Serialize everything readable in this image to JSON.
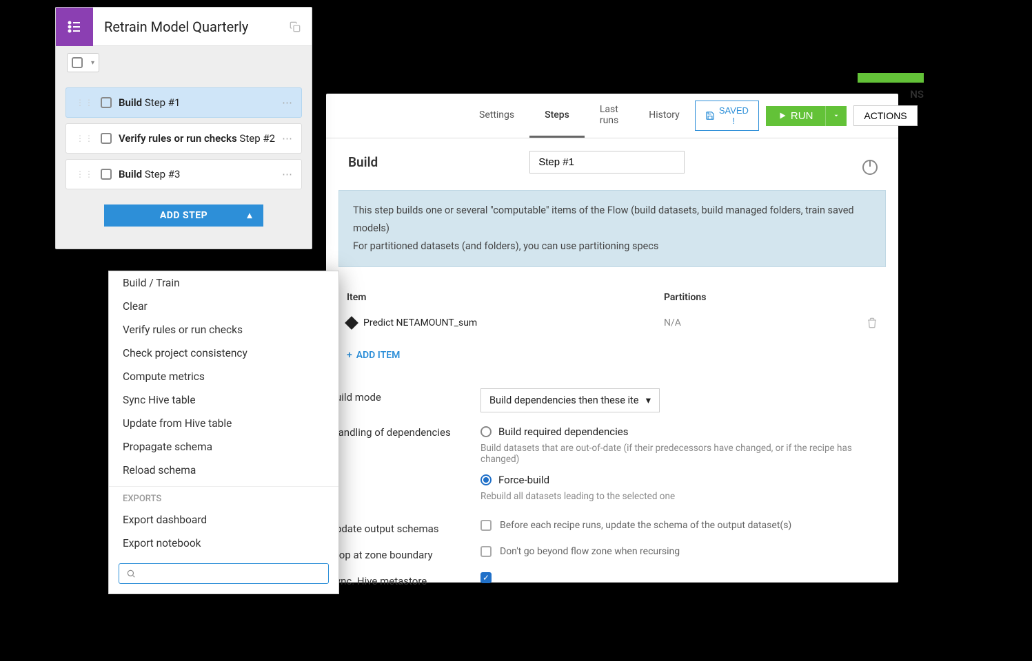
{
  "scenario": {
    "title": "Retrain Model Quarterly",
    "steps": [
      {
        "name": "Build",
        "suffix": "Step #1",
        "selected": true
      },
      {
        "name": "Verify rules or run checks",
        "suffix": "Step #2",
        "selected": false
      },
      {
        "name": "Build",
        "suffix": "Step #3",
        "selected": false
      }
    ],
    "add_step_label": "ADD STEP"
  },
  "dropdown": {
    "items": [
      "Build / Train",
      "Clear",
      "Verify rules or run checks",
      "Check project consistency",
      "Compute metrics",
      "Sync Hive table",
      "Update from Hive table",
      "Propagate schema",
      "Reload schema"
    ],
    "exports_header": "EXPORTS",
    "exports": [
      "Export dashboard",
      "Export notebook"
    ]
  },
  "main": {
    "tabs": {
      "settings": "Settings",
      "steps": "Steps",
      "last_runs": "Last runs",
      "history": "History"
    },
    "saved": "SAVED !",
    "run": "RUN",
    "actions": "ACTIONS",
    "ns_fragment": "NS",
    "step_title": "Build",
    "step_name": "Step #1",
    "banner_line1": "This step builds one or several \"computable\" items of the Flow (build datasets, build managed folders, train saved models)",
    "banner_line2": "For partitioned datasets (and folders), you can use partitioning specs",
    "items_header": {
      "item": "Item",
      "partitions": "Partitions"
    },
    "item_row": {
      "name": "Predict NETAMOUNT_sum",
      "partitions": "N/A"
    },
    "add_item": "ADD ITEM",
    "form": {
      "build_mode_label": "uild mode",
      "build_mode_value": "Build dependencies then these ite",
      "handling_label": "landling of dependencies",
      "dep_option1": "Build required dependencies",
      "dep_help1": "Build datasets that are out-of-date (if their predecessors have changed, or if the recipe has changed)",
      "dep_option2": "Force-build",
      "dep_help2": "Rebuild all datasets leading to the selected one",
      "update_label": "pdate output schemas",
      "update_help": "Before each recipe runs, update the schema of the output dataset(s)",
      "stop_label": "top at zone boundary",
      "stop_help": "Don't go beyond flow zone when recursing",
      "sync_label": "ync. Hive metastore"
    }
  }
}
